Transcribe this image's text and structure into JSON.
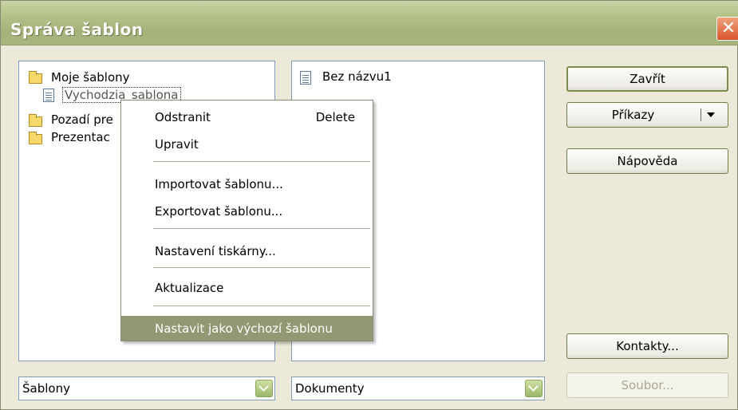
{
  "window": {
    "title": "Správa šablon",
    "close_glyph": "✕"
  },
  "left_panel": {
    "items": [
      {
        "label": "Moje šablony",
        "icon": "open-folder-icon"
      },
      {
        "label": "Vychodzia_sablona",
        "icon": "document-icon",
        "selected": true
      },
      {
        "label": "Pozadí pre",
        "icon": "folder-icon"
      },
      {
        "label": "Prezentac",
        "icon": "folder-icon"
      }
    ]
  },
  "right_panel": {
    "items": [
      {
        "label": "Bez názvu1",
        "icon": "document-icon"
      }
    ]
  },
  "buttons": {
    "close": "Zavřít",
    "commands": "Příkazy",
    "help": "Nápověda",
    "contacts": "Kontakty...",
    "file": "Soubor..."
  },
  "combos": {
    "left_value": "Šablony",
    "right_value": "Dokumenty"
  },
  "context_menu": {
    "delete": {
      "label": "Odstranit",
      "shortcut": "Delete"
    },
    "edit": "Upravit",
    "import": "Importovat šablonu...",
    "export": "Exportovat šablonu...",
    "printer": "Nastavení tiskárny...",
    "update": "Aktualizace",
    "set_default": "Nastavit jako výchozí šablonu"
  },
  "colors": {
    "titlebar": "#b3c188",
    "highlight": "#929874",
    "close_button": "#d9552b"
  }
}
